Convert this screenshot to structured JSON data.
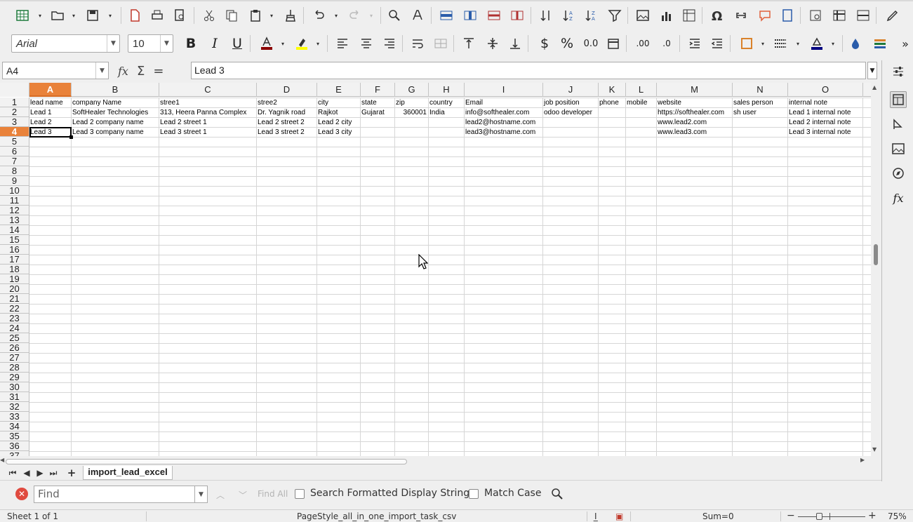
{
  "toolbar": {
    "font_name": "Arial",
    "font_size": "10",
    "overflow_label": "»"
  },
  "formula_bar": {
    "name_box": "A4",
    "fx_label": "fx",
    "sum_label": "Σ",
    "equals_label": "=",
    "formula_value": "Lead 3"
  },
  "columns": [
    {
      "label": "A",
      "selected": true
    },
    {
      "label": "B"
    },
    {
      "label": "C"
    },
    {
      "label": "D"
    },
    {
      "label": "E"
    },
    {
      "label": "F"
    },
    {
      "label": "G"
    },
    {
      "label": "H"
    },
    {
      "label": "I"
    },
    {
      "label": "J"
    },
    {
      "label": "K"
    },
    {
      "label": "L"
    },
    {
      "label": "M"
    },
    {
      "label": "N"
    },
    {
      "label": "O"
    }
  ],
  "rows": [
    "1",
    "2",
    "3",
    "4",
    "5",
    "6",
    "7",
    "8",
    "9",
    "10",
    "11",
    "12",
    "13",
    "14",
    "15",
    "16",
    "17",
    "18",
    "19",
    "20",
    "21",
    "22",
    "23",
    "24",
    "25",
    "26",
    "27",
    "28",
    "29",
    "30",
    "31",
    "32",
    "33",
    "34",
    "35",
    "36",
    "37"
  ],
  "selected_row": "4",
  "cells": [
    [
      "lead name",
      "company Name",
      "stree1",
      "stree2",
      "city",
      "state",
      "zip",
      "country",
      "Email",
      "job position",
      "phone",
      "mobile",
      "website",
      "sales person",
      "internal note"
    ],
    [
      "Lead 1",
      "SoftHealer Technologies",
      "313, Heera Panna Complex",
      "Dr. Yagnik road",
      "Rajkot",
      "Gujarat",
      "360001",
      "India",
      "info@softhealer.com",
      "odoo developer",
      "",
      "",
      "https://softhealer.com",
      "sh user",
      "Lead 1 internal note"
    ],
    [
      "Lead 2",
      "Lead 2 company name",
      "Lead 2 street 1",
      "Lead 2 street 2",
      "Lead 2 city",
      "",
      "",
      "",
      "lead2@hostname.com",
      "",
      "",
      "",
      "www.lead2.com",
      "",
      "Lead 2 internal note"
    ],
    [
      "Lead 3",
      "Lead 3 company name",
      "Lead 3 street 1",
      "Lead 3 street 2",
      "Lead 3 city",
      "",
      "",
      "",
      "lead3@hostname.com",
      "",
      "",
      "",
      "www.lead3.com",
      "",
      "Lead 3 internal note"
    ]
  ],
  "sheet_tabs": [
    "import_lead_excel"
  ],
  "find_bar": {
    "placeholder": "Find",
    "find_all": "Find All",
    "search_formatted": "Search Formatted Display String",
    "match_case": "Match Case"
  },
  "status_bar": {
    "sheet": "Sheet 1 of 1",
    "page_style": "PageStyle_all_in_one_import_task_csv",
    "sum": "Sum=0",
    "zoom": "75%"
  },
  "colors": {
    "selection_accent": "#e9823a",
    "font_color": "#8b0000",
    "highlight": "#ffff00",
    "border_color": "#000080"
  }
}
